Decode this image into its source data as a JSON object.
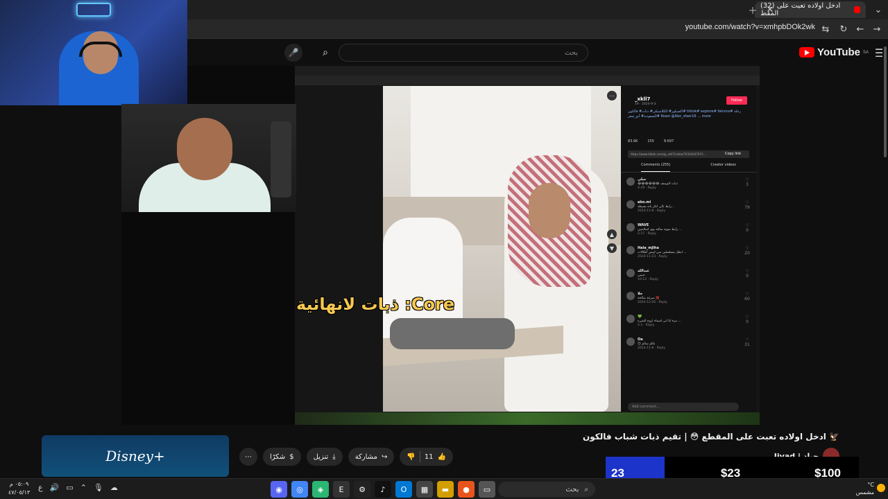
{
  "browser": {
    "tab_title": "(32) ادخل اولاده تعبت على المقط",
    "url": "youtube.com/watch?v=xmhpbDOk2wk"
  },
  "youtube": {
    "logo_text": "YouTube",
    "region": "SA",
    "search_placeholder": "بحث"
  },
  "video": {
    "caption": "ذبات لانهائية :Core",
    "title": "ادخل اولاده تعبت على المقطع 😳 | تقيم ذبات شباب فالكون 🦅",
    "channel_name": "Jiyad | جياد",
    "likes": "11",
    "share_label": "مشاركة",
    "download_label": "تنزيل",
    "thanks_label": "شكرًا"
  },
  "tiktok": {
    "username": "_xkll7",
    "date": "19 · 2024-9-3",
    "follow_label": "Follow",
    "description": "اكسبلور# الكلاسيكي# ذبات# فالكون# tiktok# explore# falcons# رحلة السعودية# أبو_سفر# Roasi @Abo_sfaer16 … more",
    "stats": [
      "83.6K",
      "255",
      "8.697"
    ],
    "link": "https://www.tiktok.com/@_xkll7/video/74104247972…",
    "copy_link": "Copy link",
    "tabs": [
      "Comments (255)",
      "Creator videos"
    ],
    "comments": [
      {
        "user": "سلي",
        "text": "😂😂😂😂😂😂 ذبات لاتوصف",
        "meta": "4-29 · Reply",
        "likes": "3"
      },
      {
        "user": "abo.mi",
        "text": "رابط بالي انكر بانه بسيطه…",
        "meta": "2024-11-8 · Reply",
        "likes": "79"
      },
      {
        "user": "WAVE",
        "text": "رابط صوته سالته بوي اسلاميين ...",
        "meta": "5-17 · Reply",
        "likes": "0"
      },
      {
        "user": "Hala_mJiha",
        "text": "ابطل مسلسلين سن لبيش اطلالات ...",
        "meta": "2024-11-23 · Reply",
        "likes": "20"
      },
      {
        "user": "عبدالله",
        "text": "حبيبي",
        "meta": "10-12 · Reply",
        "likes": "0"
      },
      {
        "user": "خلا",
        "text": "سرعة صالحة ❌",
        "meta": "2024-12-20 · Reply",
        "likes": "60"
      },
      {
        "user": "💚",
        "text": "مرة ابا ابي اسماه اروح الشيء ...",
        "meta": "5-1 · Reply",
        "likes": "0"
      },
      {
        "user": "Oa",
        "text": "😊 عالم سالم",
        "meta": "2024-11-8 · Reply",
        "likes": "31"
      }
    ],
    "add_comment": "Add comment..."
  },
  "promo": {
    "brand": "Disney+"
  },
  "donation": {
    "count": "23",
    "current": "$23",
    "goal": "$100"
  },
  "taskbar": {
    "search": "بحث",
    "time": "٠٥:٠٩ م",
    "date": "٤٧/٠٥/١٣",
    "weather_temp": "°C",
    "weather_text": "مشمس"
  },
  "colors": {
    "yt_red": "#ff0000",
    "tiktok_follow": "#fe2c55",
    "donation_blue": "#1c34c9",
    "caption_gold": "#f6c850"
  }
}
